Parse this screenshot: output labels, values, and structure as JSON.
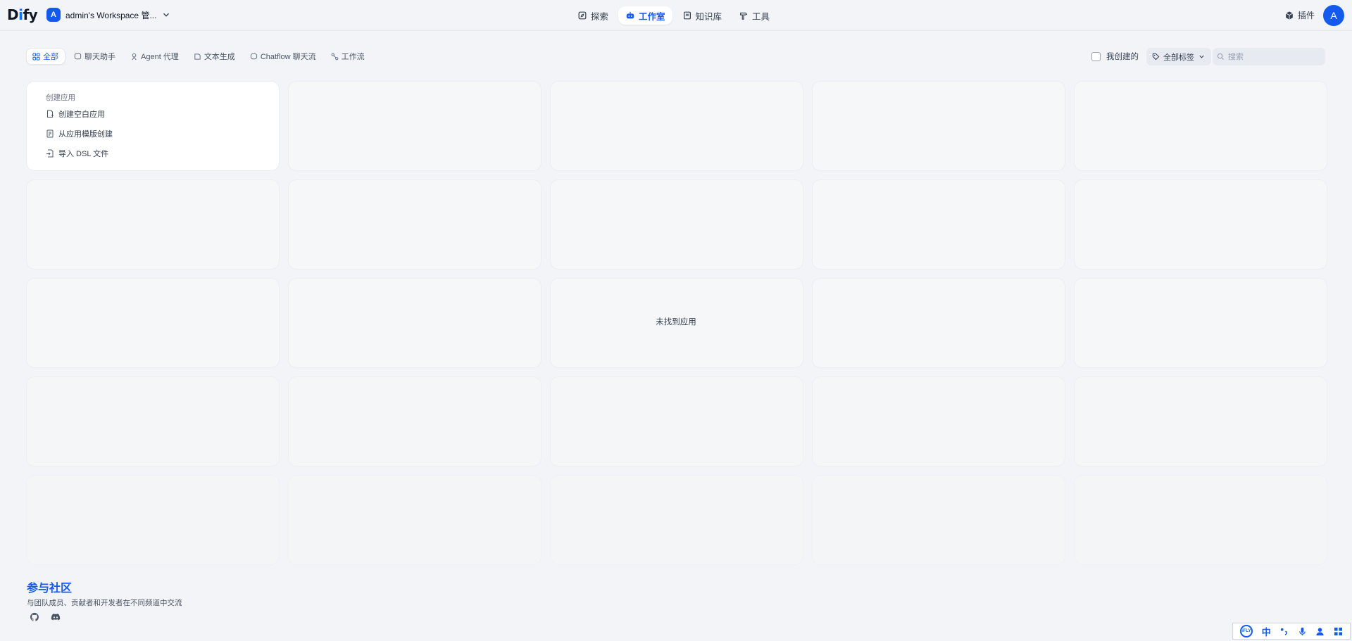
{
  "header": {
    "logo_prefix": "D",
    "logo_i": "i",
    "logo_suffix": "fy",
    "workspace": {
      "avatar": "A",
      "name": "admin's Workspace 管..."
    },
    "nav": [
      {
        "label": "探索",
        "icon": "compass-icon"
      },
      {
        "label": "工作室",
        "icon": "robot-icon",
        "active": true
      },
      {
        "label": "知识库",
        "icon": "book-icon"
      },
      {
        "label": "工具",
        "icon": "hammer-icon"
      }
    ],
    "plugin_label": "插件",
    "user_avatar": "A"
  },
  "filters": {
    "tabs": [
      {
        "label": "全部",
        "icon": "grid-icon",
        "active": true
      },
      {
        "label": "聊天助手",
        "icon": "chat-icon"
      },
      {
        "label": "Agent 代理",
        "icon": "agent-icon"
      },
      {
        "label": "文本生成",
        "icon": "edit-icon"
      },
      {
        "label": "Chatflow 聊天流",
        "icon": "chatflow-icon"
      },
      {
        "label": "工作流",
        "icon": "workflow-icon"
      }
    ],
    "mine_label": "我创建的",
    "tags_label": "全部标签",
    "search_placeholder": "搜索"
  },
  "create_card": {
    "title": "创建应用",
    "items": [
      "创建空白应用",
      "从应用模版创建",
      "导入 DSL 文件"
    ]
  },
  "empty_message": "未找到应用",
  "community": {
    "title": "参与社区",
    "subtitle": "与团队成员、贡献者和开发者在不同频道中交流"
  },
  "ime": {
    "brand": "iFLY",
    "lang": "中"
  },
  "colors": {
    "accent": "#155aef",
    "background": "#f2f4f7"
  }
}
